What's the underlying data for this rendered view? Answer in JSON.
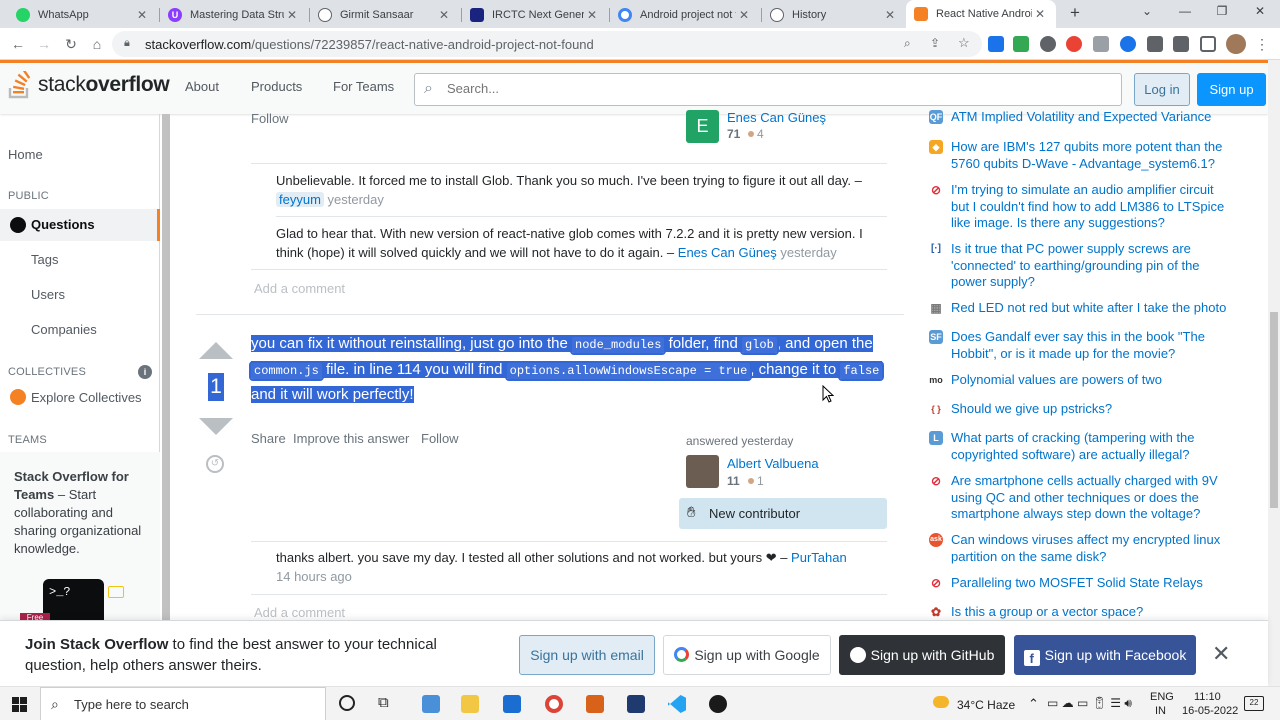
{
  "browser": {
    "tabs": [
      {
        "title": "WhatsApp",
        "color": "#25d366"
      },
      {
        "title": "Mastering Data Structures",
        "color": "#8b3dff"
      },
      {
        "title": "Girmit Sansaar",
        "color": "#5f6368"
      },
      {
        "title": "IRCTC Next Generation",
        "color": "#1a237e"
      },
      {
        "title": "Android project not fo",
        "color": "#4285f4"
      },
      {
        "title": "History",
        "color": "#5f6368"
      },
      {
        "title": "React Native Android",
        "color": "#f48225"
      }
    ],
    "new_tab": "+",
    "url_domain": "stackoverflow.com",
    "url_path": "/questions/72239857/react-native-android-project-not-found"
  },
  "so_header": {
    "logo_light": "stack",
    "logo_bold": "overflow",
    "nav": [
      "About",
      "Products",
      "For Teams"
    ],
    "search_placeholder": "Search...",
    "login": "Log in",
    "signup": "Sign up"
  },
  "left_nav": {
    "home": "Home",
    "public_heading": "PUBLIC",
    "questions": "Questions",
    "tags": "Tags",
    "users": "Users",
    "companies": "Companies",
    "collectives_heading": "COLLECTIVES",
    "explore_collectives": "Explore Collectives",
    "teams_heading": "TEAMS",
    "teams_title": "Stack Overflow for Teams",
    "teams_desc": " – Start collaborating and sharing organizational knowledge.",
    "teams_prompt": ">_?",
    "free_badge": "Free"
  },
  "prev_answer": {
    "follow": "Follow",
    "author": "Enes Can Güneş",
    "rep": "71",
    "bronze": "4",
    "avatar_letter": "E",
    "comments": [
      {
        "text": "Unbelievable. It forced me to install Glob. Thank you so much. I've been trying to figure it out all day. – ",
        "author": "feyyum",
        "time": "yesterday"
      },
      {
        "text": "Glad to hear that. With new version of react-native glob comes with 7.2.2 and it is pretty new version. I think (hope) it will solved quickly and we will not have to do it again. – ",
        "author": "Enes Can Güneş",
        "time": "yesterday"
      }
    ],
    "add_comment": "Add a comment"
  },
  "answer": {
    "score": "1",
    "parts": [
      {
        "t": "you can fix it without reinstalling, just go into the "
      },
      {
        "c": "node_modules"
      },
      {
        "t": " folder, find "
      },
      {
        "c": "glob"
      },
      {
        "t": ", and open the "
      },
      {
        "c": "common.js"
      },
      {
        "t": " file. in line 114 you will find "
      },
      {
        "c": "options.allowWindowsEscape = true"
      },
      {
        "t": ", change it to "
      },
      {
        "c": "false"
      },
      {
        "t": " and it will work perfectly!"
      }
    ],
    "share": "Share",
    "improve": "Improve this answer",
    "follow": "Follow",
    "answered": "answered yesterday",
    "author": "Albert Valbuena",
    "rep": "11",
    "bronze": "1",
    "new_contributor": "New contributor",
    "comment": {
      "text": "thanks albert. you save my day. I tested all other solutions and not worked. but yours ❤ – ",
      "author": "PurTahan",
      "time": "14 hours ago"
    },
    "add_comment": "Add a comment"
  },
  "hot_questions": [
    {
      "title": "ATM Implied Volatility and Expected Variance",
      "color": "#5b9bd5",
      "glyph": "QF"
    },
    {
      "title": "How are IBM's 127 qubits more potent than the 5760 qubits D-Wave - Advantage_system6.1?",
      "color": "#f5a623",
      "glyph": "◆"
    },
    {
      "title": "I'm trying to simulate an audio amplifier circuit but I couldn't find how to add LM386 to LTSpice like image. Is there any suggestions?",
      "color": "#e0313c",
      "glyph": "⊘"
    },
    {
      "title": "Is it true that PC power supply screws are 'connected' to earthing/grounding pin of the power supply?",
      "color": "#2c5fa8",
      "glyph": "[·]"
    },
    {
      "title": "Red LED not red but white after I take the photo",
      "color": "#7a7a7a",
      "glyph": "▦"
    },
    {
      "title": "Does Gandalf ever say this in the book \"The Hobbit\", or is it made up for the movie?",
      "color": "#5b9bd5",
      "glyph": "SF"
    },
    {
      "title": "Polynomial values are powers of two",
      "color": "#333333",
      "glyph": "mo"
    },
    {
      "title": "Should we give up pstricks?",
      "color": "#c0392b",
      "glyph": "{ }"
    },
    {
      "title": "What parts of cracking (tampering with the copyrighted software) are actually illegal?",
      "color": "#5b9bd5",
      "glyph": "L"
    },
    {
      "title": "Are smartphone cells actually charged with 9V using QC and other techniques or does the smartphone always step down the voltage?",
      "color": "#e0313c",
      "glyph": "⊘"
    },
    {
      "title": "Can windows viruses affect my encrypted linux partition on the same disk?",
      "color": "#e8542f",
      "glyph": "ask"
    },
    {
      "title": "Paralleling two MOSFET Solid State Relays",
      "color": "#e0313c",
      "glyph": "⊘"
    },
    {
      "title": "Is this a group or a vector space?",
      "color": "#c0392b",
      "glyph": "✿"
    }
  ],
  "banner": {
    "bold": "Join Stack Overflow",
    "rest": " to find the best answer to your technical question, help others answer theirs.",
    "email": "Sign up with email",
    "google": "Sign up with Google",
    "github": "Sign up with GitHub",
    "facebook": "Sign up with Facebook",
    "close": "✕"
  },
  "taskbar": {
    "search_placeholder": "Type here to search",
    "weather": "34°C  Haze",
    "lang1": "ENG",
    "lang2": "IN",
    "time": "11:10",
    "date": "16-05-2022",
    "notif": "22"
  }
}
